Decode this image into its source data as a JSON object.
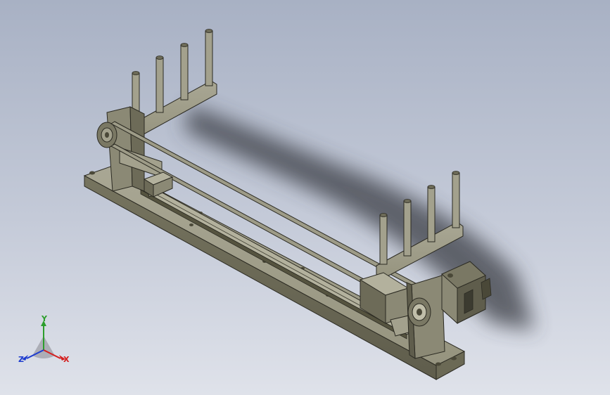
{
  "viewport": {
    "background_top": "#a8b1c4",
    "background_bottom": "#dfe2ea",
    "part_color": "#8f8d7b"
  },
  "axis_triad": {
    "x_label": "X",
    "y_label": "Y",
    "z_label": "Z",
    "x_color": "#d42020",
    "y_color": "#2c9e2c",
    "z_color": "#1e3ccf"
  },
  "model": {
    "components": [
      "base-plate",
      "linear-rail",
      "carriage-left",
      "carriage-right",
      "belt",
      "idler-pulley",
      "drive-pulley",
      "servo-motor",
      "upright-post-group-left",
      "upright-post-group-right"
    ]
  }
}
